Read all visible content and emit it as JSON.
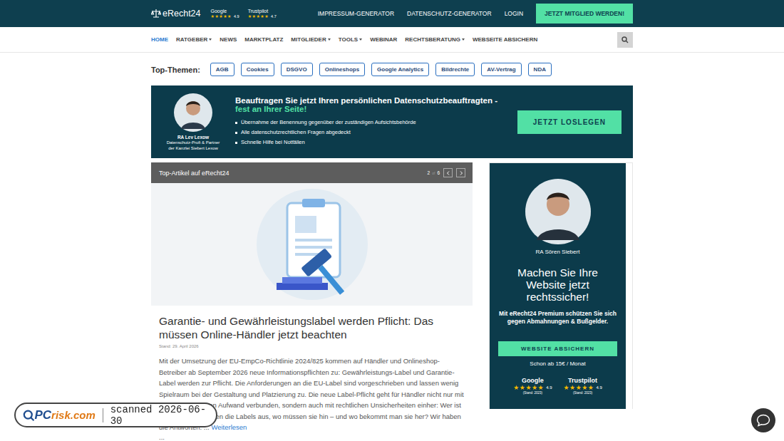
{
  "header": {
    "logo": "eRecht24",
    "ratings": [
      {
        "name": "Google",
        "score": "4.9",
        "stars": 5
      },
      {
        "name": "Trustpilot",
        "score": "4.7",
        "stars": 5
      }
    ],
    "links": [
      "IMPRESSUM-GENERATOR",
      "DATENSCHUTZ-GENERATOR",
      "LOGIN"
    ],
    "cta": "JETZT MITGLIED WERDEN!"
  },
  "nav": {
    "items": [
      {
        "label": "HOME",
        "dropdown": false,
        "selected": true
      },
      {
        "label": "RATGEBER",
        "dropdown": true,
        "selected": false
      },
      {
        "label": "NEWS",
        "dropdown": false,
        "selected": false
      },
      {
        "label": "MARKTPLATZ",
        "dropdown": false,
        "selected": false
      },
      {
        "label": "MITGLIEDER",
        "dropdown": true,
        "selected": false
      },
      {
        "label": "TOOLS",
        "dropdown": true,
        "selected": false
      },
      {
        "label": "WEBINAR",
        "dropdown": false,
        "selected": false
      },
      {
        "label": "RECHTSBERATUNG",
        "dropdown": true,
        "selected": false
      },
      {
        "label": "WEBSEITE ABSICHERN",
        "dropdown": false,
        "selected": false
      }
    ]
  },
  "topics": {
    "label": "Top-Themen:",
    "items": [
      "AGB",
      "Cookies",
      "DSGVO",
      "Onlineshops",
      "Google Analytics",
      "Bildrechte",
      "AV-Vertrag",
      "NDA"
    ]
  },
  "banner": {
    "person": {
      "name": "RA Lev Lexow",
      "role": "Datenschutz-Profi & Partner",
      "firm": "der Kanzlei Siebert Lexow"
    },
    "headline": "Beauftragen Sie jetzt Ihren persönlichen Datenschutzbeauftragten -",
    "highlight": "fest an Ihrer Seite!",
    "bullets": [
      "Übernahme der Benennung gegenüber der zuständigen Aufsichtsbehörde",
      "Alle datenschutzrechtlichen Fragen abgedeckt",
      "Schnelle Hilfe bei Notfällen"
    ],
    "button": "JETZT LOSLEGEN"
  },
  "slider": {
    "title": "Top-Artikel auf eRecht24",
    "current": "2",
    "separator": "of",
    "total": "6",
    "article": {
      "title": "Garantie- und Gewährleistungslabel werden Pflicht: Das müssen Online-Händler jetzt beachten",
      "date": "Stand: 29. April 2026",
      "text": "Mit der Umsetzung der EU-EmpCo-Richtlinie 2024/825 kommen auf Händler und Onlineshop-Betreiber ab September 2026 neue Informationspflichten zu: Gewährleistungs-Label und Garantie-Label werden zur Pflicht. Die Anforderungen an die EU-Label sind vorgeschrieben und lassen wenig Spielraum bei der Gestaltung und Platzierung zu. Die neue Label-Pflicht geht für Händler nicht nur mit einem zusätzlichen Aufwand verbunden, sondern auch mit rechtlichen Unsicherheiten einher: Wer ist betroffen? Wie sehen die Labels aus, wo müssen sie hin – und wo bekommt man sie her? Wir haben die Antworten. ...",
      "more": "Weiterlesen",
      "ellipsis": "..."
    }
  },
  "ad": {
    "person": "RA Sören Siebert",
    "headline": "Machen Sie Ihre Website jetzt rechtssicher!",
    "sub": "Mit eRecht24 Premium schützen Sie sich gegen Abmahnungen & Bußgelder.",
    "button": "WEBSITE ABSICHERN",
    "price": "Schon ab 15€ / Monat",
    "ratings": [
      {
        "name": "Google",
        "score": "4.9",
        "stars": 5,
        "note": "(Stand: 2023)"
      },
      {
        "name": "Trustpilot",
        "score": "4.9",
        "stars": 5,
        "note": "(Stand: 2023)"
      }
    ]
  },
  "watermark": {
    "logo_a": "PC",
    "logo_b": "risk.com",
    "text": "scanned 2026-06-30"
  }
}
